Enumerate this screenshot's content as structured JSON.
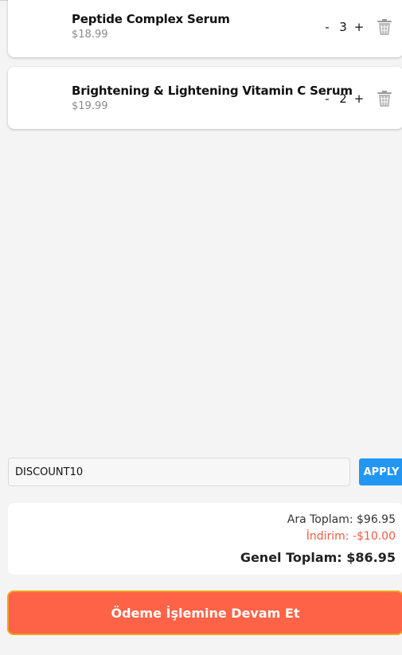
{
  "cart": {
    "items": [
      {
        "name": "Peptide Complex Serum",
        "price": "$18.99",
        "quantity": "3",
        "decrement_label": "-",
        "increment_label": "+"
      },
      {
        "name": "Brightening & Lightening Vitamin C Serum",
        "price": "$19.99",
        "quantity": "2",
        "decrement_label": "-",
        "increment_label": "+"
      }
    ]
  },
  "discount": {
    "code_value": "DISCOUNT10",
    "apply_label": "APPLY"
  },
  "summary": {
    "subtotal": "Ara Toplam: $96.95",
    "discount": "İndirim: -$10.00",
    "total": "Genel Toplam: $86.95"
  },
  "checkout": {
    "label": "Ödeme İşlemine Devam Et"
  },
  "colors": {
    "apply_button": "#2196f3",
    "checkout_button": "#ff6347",
    "checkout_border": "#f0a21a",
    "discount_text": "#ef5b44"
  },
  "icons": [
    "trash-icon"
  ]
}
